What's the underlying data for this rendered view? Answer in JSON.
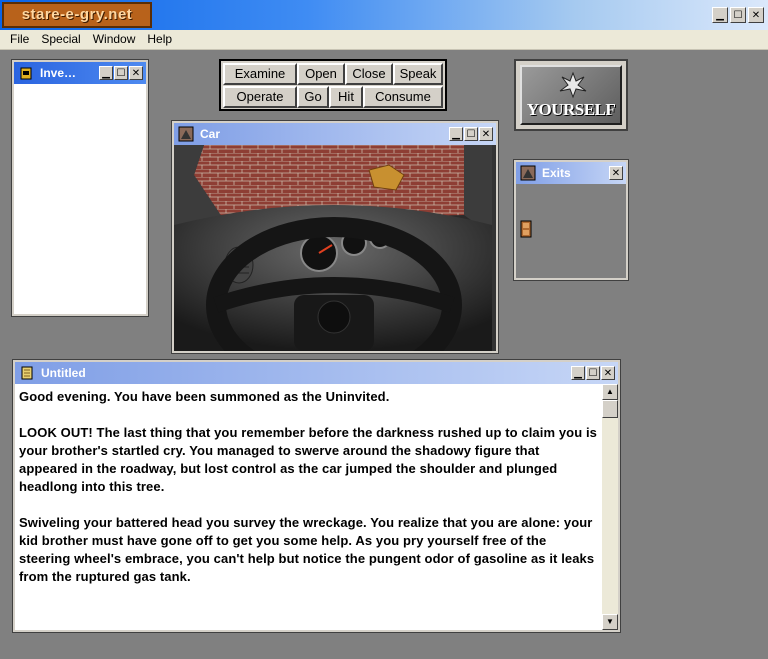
{
  "app": {
    "logo_text": "stare-e-gry.net"
  },
  "menu": [
    "File",
    "Special",
    "Window",
    "Help"
  ],
  "inventory": {
    "title": "Inve…"
  },
  "commands": {
    "row1": [
      "Examine",
      "Open",
      "Close",
      "Speak"
    ],
    "row2": [
      "Operate",
      "Go",
      "Hit",
      "Consume"
    ]
  },
  "yourself": {
    "label": "YOURSELF"
  },
  "car": {
    "title": "Car"
  },
  "exits": {
    "title": "Exits"
  },
  "text_window": {
    "title": "Untitled",
    "paragraphs": [
      "Good evening.  You have been summoned as the Uninvited.",
      "LOOK OUT!  The last thing that you remember before the darkness rushed up to claim you is your brother's startled cry.  You managed to swerve around the shadowy figure that appeared in the roadway, but lost control as the car jumped the shoulder and plunged headlong into this tree.",
      "Swiveling your battered head you survey the wreckage.  You realize that you are alone: your kid brother must have gone off to get you some help.  As you pry yourself free of the steering wheel's embrace, you can't help but notice the pungent odor of gasoline as it leaks from the ruptured gas tank."
    ]
  }
}
